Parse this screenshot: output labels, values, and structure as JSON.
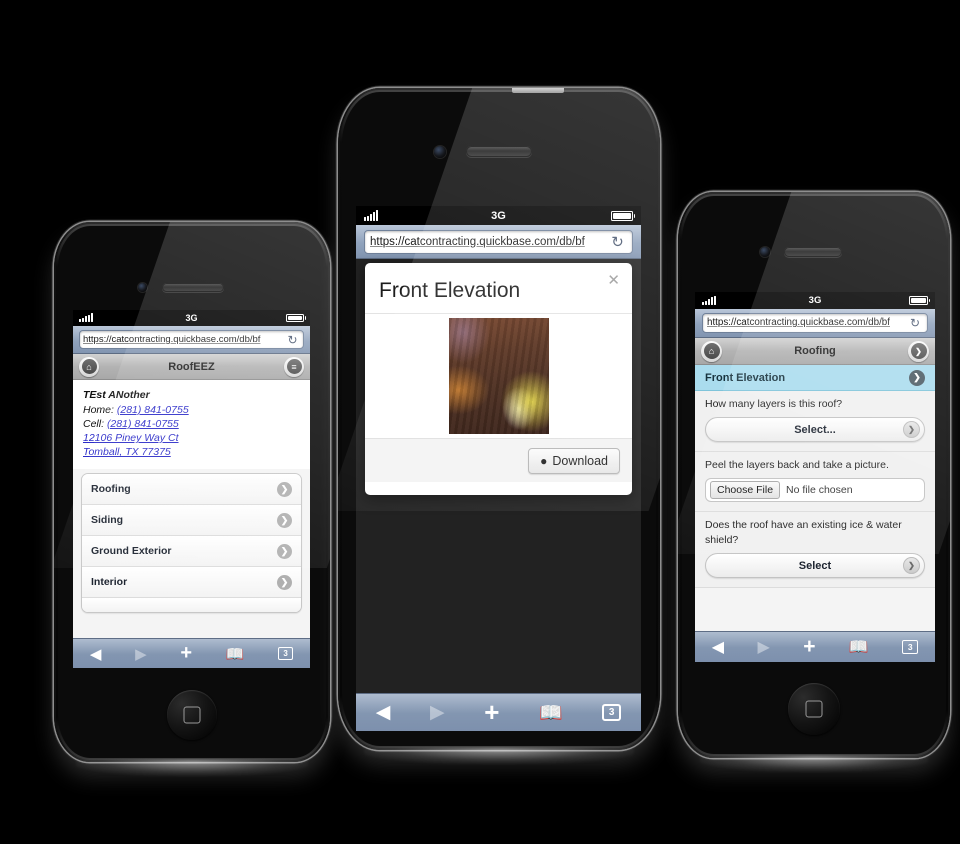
{
  "background_color": "#000000",
  "browser": {
    "url": "https://catcontracting.quickbase.com/db/bf",
    "carrier": "3G",
    "reload_icon": "reload-icon",
    "toolbar": {
      "back": "back-icon",
      "forward": "forward-icon",
      "share": "plus-icon",
      "bookmarks": "book-icon",
      "tabs_label": "3"
    }
  },
  "phone_left": {
    "app_title": "RoofEEZ",
    "home_icon": "home-icon",
    "menu_icon": "menu-icon",
    "contact": {
      "name": "TEst ANother",
      "home_label": "Home:",
      "home_phone": "(281) 841-0755",
      "cell_label": "Cell:",
      "cell_phone": "(281) 841-0755",
      "address_line1": "12106 Piney Way Ct",
      "address_line2": "Tomball, TX 77375"
    },
    "list": [
      {
        "label": "Roofing"
      },
      {
        "label": "Siding"
      },
      {
        "label": "Ground Exterior"
      },
      {
        "label": "Interior"
      }
    ]
  },
  "phone_center": {
    "modal": {
      "title": "Front Elevation",
      "close_icon": "close-icon",
      "image_alt": "attached-photo",
      "download_label": "Download",
      "download_icon": "download-circle-icon"
    }
  },
  "phone_right": {
    "app_title": "Roofing",
    "home_icon": "home-icon",
    "menu_icon": "chevron-down-icon",
    "selected_row": {
      "label": "Front Elevation",
      "chevron_icon": "chevron-right-icon",
      "highlight_color": "#aadcee"
    },
    "fields": [
      {
        "type": "select",
        "label": "How many layers is this roof?",
        "value": "Select...",
        "dropdown_icon": "chevron-down-icon"
      },
      {
        "type": "file",
        "label": "Peel the layers back and take a picture.",
        "button_label": "Choose File",
        "value": "No file chosen"
      },
      {
        "type": "select",
        "label": "Does the roof have an existing ice & water shield?",
        "value": "Select",
        "dropdown_icon": "chevron-down-icon"
      }
    ]
  }
}
